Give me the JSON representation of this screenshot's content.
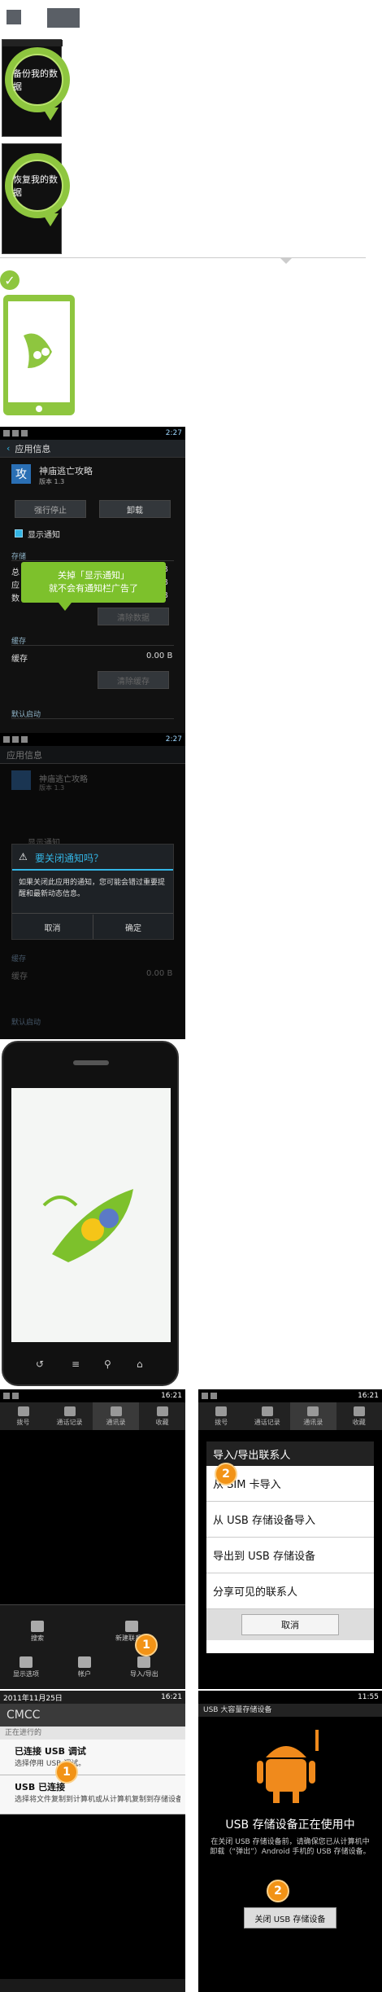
{
  "steps": {
    "backup_label": "备份我的数据",
    "restore_label": "恢复我的数据"
  },
  "app_info_1": {
    "status_time": "2:27",
    "title": "应用信息",
    "app_name": "神庙逃亡攻略",
    "app_version": "版本 1.3",
    "app_icon_char": "攻",
    "force_stop": "强行停止",
    "uninstall": "卸载",
    "show_notif": "显示通知",
    "storage": "存储",
    "total_prefix": "总",
    "app_prefix": "应",
    "data_prefix": "数",
    "b_suffix_1": "B",
    "b_suffix_2": "B",
    "b_suffix_3": "B",
    "clear_data": "清除数据",
    "cache_section": "缓存",
    "cache_label": "缓存",
    "cache_value": "0.00 B",
    "clear_cache": "清除缓存",
    "default_launch": "默认启动",
    "tip_line1": "关掉「显示通知」",
    "tip_line2": "就不会有通知栏广告了"
  },
  "app_info_2": {
    "status_time": "2:27",
    "title": "应用信息",
    "app_name": "神庙逃亡攻略",
    "app_version": "版本 1.3",
    "show_notif": "显示通知",
    "dialog_title": "要关闭通知吗？",
    "dialog_body": "如果关闭此应用的通知，您可能会错过重要提醒和最新动态信息。",
    "cancel": "取消",
    "ok": "确定",
    "cache_section": "缓存",
    "cache_label": "缓存",
    "cache_value": "0.00 B",
    "default_launch": "默认启动"
  },
  "contacts": {
    "status_time": "16:21",
    "tabs": [
      "拨号",
      "通话记录",
      "通讯录",
      "收藏"
    ],
    "menu": [
      "搜索",
      "新建联系人",
      "显示选项",
      "帐户",
      "导入/导出"
    ],
    "badge1": "1"
  },
  "import_export": {
    "status_time": "16:21",
    "tabs": [
      "拨号",
      "通话记录",
      "通讯录",
      "收藏"
    ],
    "dialog_title": "导入/导出联系人",
    "options": [
      "从 SIM 卡导入",
      "从 USB 存储设备导入",
      "导出到 USB 存储设备",
      "分享可见的联系人"
    ],
    "cancel": "取消",
    "badge2": "2"
  },
  "notif_shade": {
    "date": "2011年11月25日",
    "time": "16:21",
    "carrier": "CMCC",
    "ongoing": "正在进行的",
    "usb_debug_title": "已连接 USB 调试",
    "usb_debug_sub": "选择停用 USB 调试。",
    "usb_conn_title": "USB 已连接",
    "usb_conn_sub": "选择将文件复制到计算机或从计算机复制到存储设备。",
    "badge1": "1"
  },
  "usb_storage": {
    "time": "11:55",
    "header": "USB 大容量存储设备",
    "in_use": "USB 存储设备正在使用中",
    "body": "在关闭 USB 存储设备前，请确保您已从计算机中卸载（“弹出”）Android 手机的 USB 存储设备。",
    "button": "关闭 USB 存储设备",
    "badge2": "2"
  },
  "colors": {
    "green": "#8ec63f",
    "orange": "#f29316",
    "holo_blue": "#33b5e5"
  }
}
